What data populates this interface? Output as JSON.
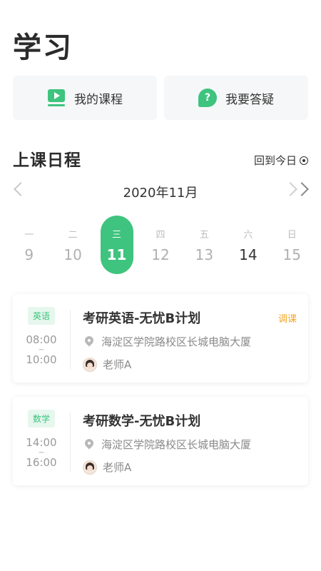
{
  "header": {
    "title": "学习"
  },
  "quick_actions": [
    {
      "label": "我的课程",
      "icon": "video-course-icon"
    },
    {
      "label": "我要答疑",
      "icon": "question-bubble-icon",
      "glyph": "?"
    }
  ],
  "schedule": {
    "title": "上课日程",
    "back_today": "回到今日",
    "month": "2020年11月",
    "days": [
      {
        "weekday": "一",
        "date": "9"
      },
      {
        "weekday": "二",
        "date": "10"
      },
      {
        "weekday": "三",
        "date": "11"
      },
      {
        "weekday": "四",
        "date": "12"
      },
      {
        "weekday": "五",
        "date": "13"
      },
      {
        "weekday": "六",
        "date": "14"
      },
      {
        "weekday": "日",
        "date": "15"
      }
    ]
  },
  "courses": [
    {
      "subject": "英语",
      "start": "08:00",
      "tilde": "~",
      "end": "10:00",
      "title": "考研英语-无忧B计划",
      "tag": "调课",
      "location": "海淀区学院路校区长城电脑大厦",
      "teacher": "老师A"
    },
    {
      "subject": "数学",
      "start": "14:00",
      "tilde": "~",
      "end": "16:00",
      "title": "考研数学-无忧B计划",
      "location": "海淀区学院路校区长城电脑大厦",
      "teacher": "老师A"
    }
  ],
  "colors": {
    "accent": "#3ec47e",
    "warning": "#f5a623"
  }
}
